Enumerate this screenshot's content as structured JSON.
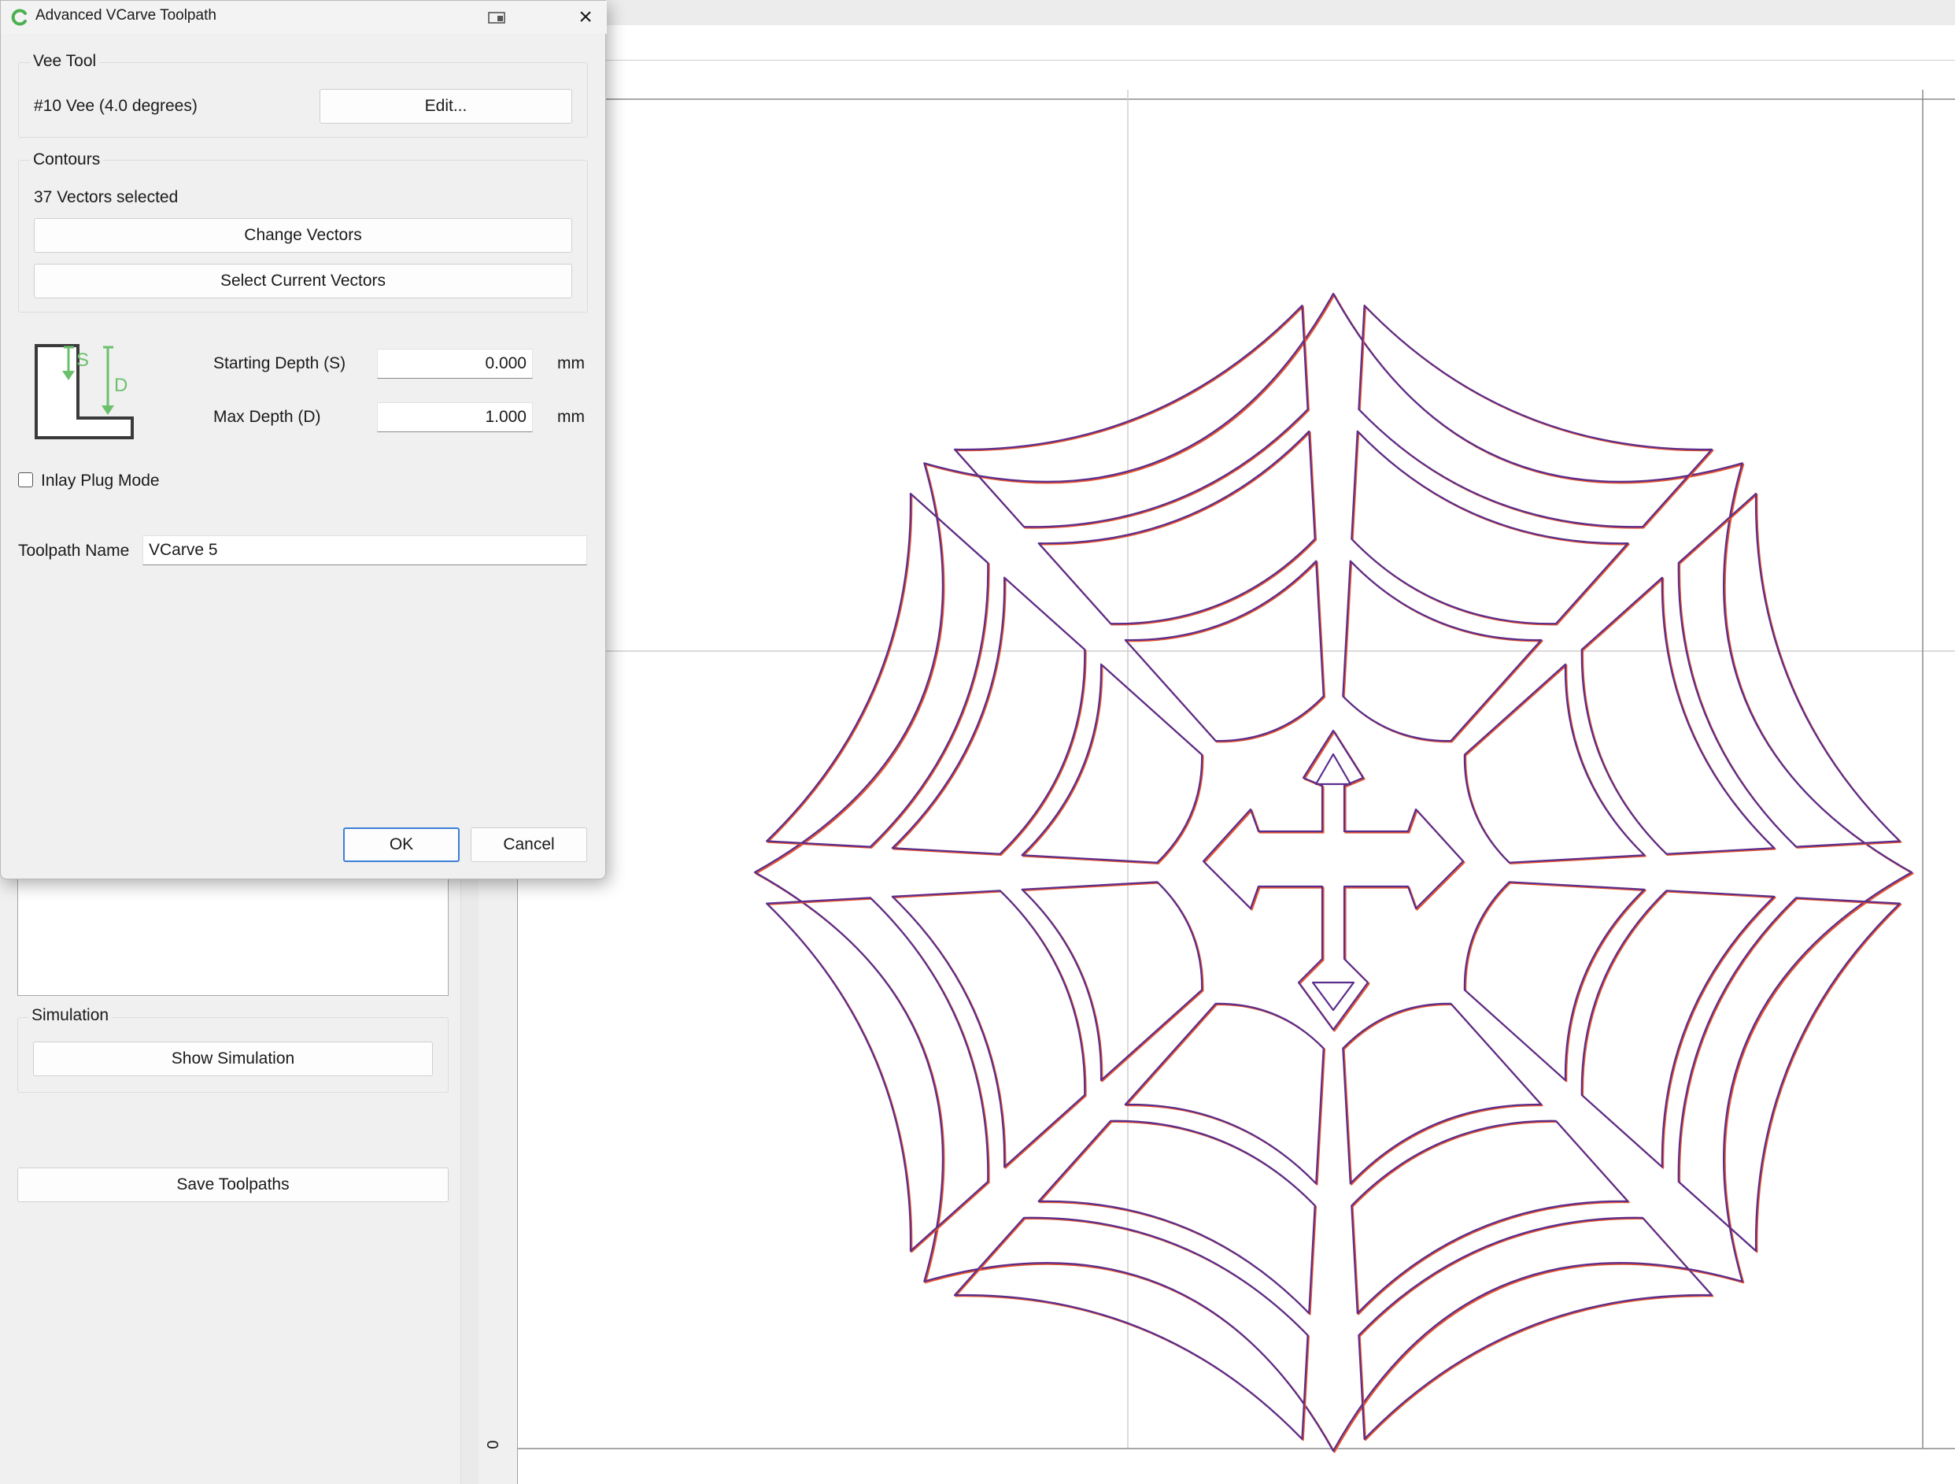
{
  "dialog": {
    "title": "Advanced VCarve Toolpath",
    "vee_tool": {
      "group_title": "Vee Tool",
      "tool_name": "#10 Vee (4.0 degrees)",
      "edit_label": "Edit..."
    },
    "contours": {
      "group_title": "Contours",
      "selection_status": "37 Vectors selected",
      "change_vectors_label": "Change Vectors",
      "select_current_label": "Select Current Vectors"
    },
    "depth": {
      "diagram_s_label": "S",
      "diagram_d_label": "D",
      "starting_depth_label": "Starting Depth (S)",
      "starting_depth_value": "0.000",
      "starting_depth_unit": "mm",
      "max_depth_label": "Max Depth (D)",
      "max_depth_value": "1.000",
      "max_depth_unit": "mm"
    },
    "inlay_plug_mode": {
      "label": "Inlay Plug Mode",
      "checked": false
    },
    "toolpath_name": {
      "label": "Toolpath Name",
      "value": "VCarve 5"
    },
    "ok_label": "OK",
    "cancel_label": "Cancel",
    "icons": {
      "app": "vcarve-logo-icon",
      "restore": "restore-window-icon",
      "close": "close-icon"
    }
  },
  "left_panel": {
    "simulation": {
      "group_title": "Simulation",
      "button_label": "Show Simulation"
    },
    "save_toolpaths_label": "Save Toolpaths"
  },
  "view": {
    "ruler_origin_label": "0",
    "drawing": "spider-web-with-gothic-cross",
    "colors": {
      "vector_outline": "#5a2d8c",
      "toolpath_preview": "#e8552d",
      "gridline": "#cfcfcf",
      "accent_green": "#6cc06c",
      "ok_focus": "#3d7fd6"
    }
  }
}
